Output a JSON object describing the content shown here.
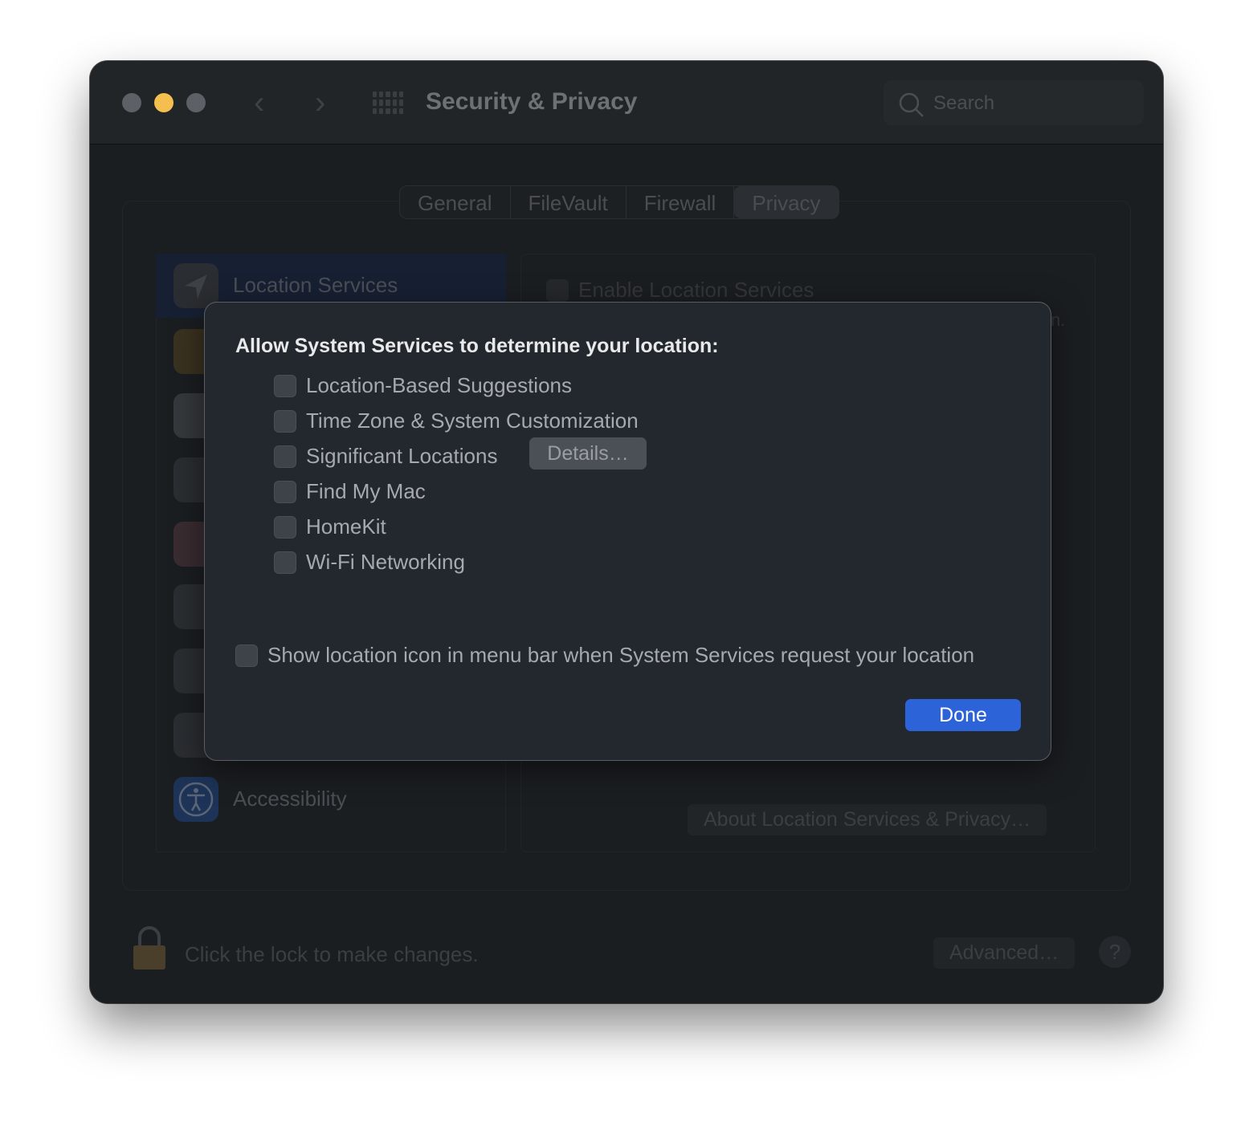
{
  "window": {
    "title": "Security & Privacy",
    "search_placeholder": "Search"
  },
  "tabs": [
    {
      "label": "General"
    },
    {
      "label": "FileVault"
    },
    {
      "label": "Firewall"
    },
    {
      "label": "Privacy",
      "selected": true
    }
  ],
  "sidebar": {
    "items": [
      {
        "label": "Location Services",
        "icon": "location-arrow-icon",
        "selected": true
      },
      {
        "label": "Accessibility",
        "icon": "accessibility-icon"
      }
    ]
  },
  "main": {
    "enable_label": "Enable Location Services",
    "about_button": "About Location Services & Privacy…",
    "partial_text": "n."
  },
  "footer": {
    "lock_text": "Click the lock to make changes.",
    "advanced_button": "Advanced…",
    "help": "?"
  },
  "dialog": {
    "heading": "Allow System Services to determine your location:",
    "options": [
      {
        "label": "Location-Based Suggestions",
        "checked": false
      },
      {
        "label": "Time Zone & System Customization",
        "checked": false
      },
      {
        "label": "Significant Locations",
        "checked": false
      },
      {
        "label": "Find My Mac",
        "checked": false
      },
      {
        "label": "HomeKit",
        "checked": false
      },
      {
        "label": "Wi-Fi Networking",
        "checked": false
      }
    ],
    "details_button": "Details…",
    "menu_bar_option": {
      "label": "Show location icon in menu bar when System Services request your location",
      "checked": false
    },
    "done_button": "Done"
  },
  "colors": {
    "accent": "#2d63d8",
    "minimize": "#f5bf4f"
  }
}
